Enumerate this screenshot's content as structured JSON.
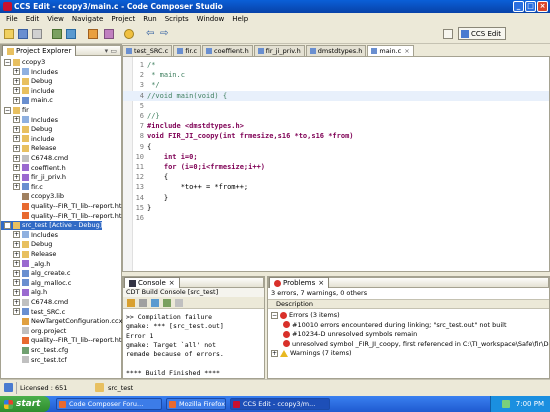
{
  "window": {
    "title": "CCS Edit - ccopy3/main.c - Code Composer Studio"
  },
  "menu": [
    "File",
    "Edit",
    "View",
    "Navigate",
    "Project",
    "Run",
    "Scripts",
    "Window",
    "Help"
  ],
  "toolbar": {
    "perspective": "CCS Edit"
  },
  "explorer": {
    "title": "Project Explorer",
    "rows": [
      {
        "label": "ccopy3",
        "indent": 0,
        "exp": "−",
        "icon": "project-icon"
      },
      {
        "label": "Includes",
        "indent": 1,
        "exp": "+",
        "icon": "includes-icon"
      },
      {
        "label": "Debug",
        "indent": 1,
        "exp": "+",
        "icon": "folder-icon"
      },
      {
        "label": "include",
        "indent": 1,
        "exp": "+",
        "icon": "folder-icon"
      },
      {
        "label": "main.c",
        "indent": 1,
        "exp": "+",
        "icon": "c-file-icon"
      },
      {
        "label": "fir",
        "indent": 0,
        "exp": "−",
        "icon": "project-icon"
      },
      {
        "label": "Includes",
        "indent": 1,
        "exp": "+",
        "icon": "includes-icon"
      },
      {
        "label": "Debug",
        "indent": 1,
        "exp": "+",
        "icon": "folder-icon"
      },
      {
        "label": "include",
        "indent": 1,
        "exp": "+",
        "icon": "folder-icon"
      },
      {
        "label": "Release",
        "indent": 1,
        "exp": "+",
        "icon": "folder-icon"
      },
      {
        "label": "C6748.cmd",
        "indent": 1,
        "exp": "+",
        "icon": "file-icon"
      },
      {
        "label": "coeffient.h",
        "indent": 1,
        "exp": "+",
        "icon": "h-file-icon"
      },
      {
        "label": "fir_ji_priv.h",
        "indent": 1,
        "exp": "+",
        "icon": "h-file-icon"
      },
      {
        "label": "fir.c",
        "indent": 1,
        "exp": "+",
        "icon": "c-file-icon"
      },
      {
        "label": "ccopy3.lib",
        "indent": 1,
        "exp": "",
        "icon": "lib-icon"
      },
      {
        "label": "quality--FIR_TI_lib--report.html",
        "indent": 1,
        "exp": "",
        "icon": "html-icon"
      },
      {
        "label": "quality--FIR_TI_lib--report.html",
        "indent": 1,
        "exp": "",
        "icon": "html-icon"
      },
      {
        "label": "src_test [Active - Debug]",
        "indent": 0,
        "exp": "−",
        "icon": "project-icon",
        "selected": true
      },
      {
        "label": "Includes",
        "indent": 1,
        "exp": "+",
        "icon": "includes-icon"
      },
      {
        "label": "Debug",
        "indent": 1,
        "exp": "+",
        "icon": "folder-icon"
      },
      {
        "label": "Release",
        "indent": 1,
        "exp": "+",
        "icon": "folder-icon"
      },
      {
        "label": "_alg.h",
        "indent": 1,
        "exp": "+",
        "icon": "h-file-icon"
      },
      {
        "label": "alg_create.c",
        "indent": 1,
        "exp": "+",
        "icon": "c-file-icon"
      },
      {
        "label": "alg_malloc.c",
        "indent": 1,
        "exp": "+",
        "icon": "c-file-icon"
      },
      {
        "label": "alg.h",
        "indent": 1,
        "exp": "+",
        "icon": "h-file-icon"
      },
      {
        "label": "C6748.cmd",
        "indent": 1,
        "exp": "+",
        "icon": "file-icon"
      },
      {
        "label": "test_SRC.c",
        "indent": 1,
        "exp": "+",
        "icon": "c-file-icon"
      },
      {
        "label": "NewTargetConfiguration.ccxml",
        "indent": 1,
        "exp": "",
        "icon": "xml-icon"
      },
      {
        "label": "org.project",
        "indent": 1,
        "exp": "",
        "icon": "file-icon"
      },
      {
        "label": "quality--FIR_TI_lib--report.html",
        "indent": 1,
        "exp": "",
        "icon": "html-icon"
      },
      {
        "label": "src_test.cfg",
        "indent": 1,
        "exp": "",
        "icon": "cfg-icon"
      },
      {
        "label": "src_test.tcf",
        "indent": 1,
        "exp": "",
        "icon": "file-icon"
      }
    ]
  },
  "editor_tabs": [
    {
      "label": "test_SRC.c",
      "active": false
    },
    {
      "label": "fir.c",
      "active": false
    },
    {
      "label": "coeffient.h",
      "active": false
    },
    {
      "label": "fir_ji_priv.h",
      "active": false
    },
    {
      "label": "dmstdtypes.h",
      "active": false
    },
    {
      "label": "main.c",
      "active": true
    }
  ],
  "code_lines": [
    {
      "n": "1",
      "text": "/*",
      "cls": "cmt"
    },
    {
      "n": "2",
      "text": " * main.c",
      "cls": "cmt"
    },
    {
      "n": "3",
      "text": " */",
      "cls": "cmt"
    },
    {
      "n": "4",
      "text": "//void main(void) {",
      "cls": "cmt"
    },
    {
      "n": "5",
      "text": "",
      "cls": ""
    },
    {
      "n": "6",
      "text": "//}",
      "cls": "cmt"
    },
    {
      "n": "7",
      "text": "#include <dmstdtypes.h>",
      "cls": "pp"
    },
    {
      "n": "8",
      "text": "void FIR_JI_coopy(int frmesize,s16 *to,s16 *from)",
      "cls": "kw"
    },
    {
      "n": "9",
      "text": "{",
      "cls": ""
    },
    {
      "n": "10",
      "text": "    int i=0;",
      "cls": "kw"
    },
    {
      "n": "11",
      "text": "    for (i=0;i<frmesize;i++)",
      "cls": "kw"
    },
    {
      "n": "12",
      "text": "    {",
      "cls": ""
    },
    {
      "n": "13",
      "text": "        *to++ = *from++;",
      "cls": ""
    },
    {
      "n": "14",
      "text": "    }",
      "cls": ""
    },
    {
      "n": "15",
      "text": "}",
      "cls": ""
    },
    {
      "n": "16",
      "text": "",
      "cls": ""
    }
  ],
  "console": {
    "tab": "Console",
    "title": "CDT Build Console [src_test]",
    "lines": [
      ">> Compilation failure",
      "gmake: *** [src_test.out]",
      "Error 1",
      "gmake: Target `all' not",
      "remade because of errors.",
      "",
      "**** Build Finished ****"
    ]
  },
  "problems": {
    "tab": "Problems",
    "summary": "3 errors, 7 warnings, 0 others",
    "column": "Description",
    "rows": [
      {
        "label": "Errors (3 items)",
        "indent": 0,
        "exp": "−",
        "type": "error-group"
      },
      {
        "label": "#10010 errors encountered during linking; \"src_test.out\" not built",
        "indent": 1,
        "exp": "",
        "type": "error"
      },
      {
        "label": "#10234-D  unresolved symbols remain",
        "indent": 1,
        "exp": "",
        "type": "error"
      },
      {
        "label": "unresolved symbol _FIR_JI_coopy, first referenced in C:\\TI_workspace\\Safe\\fir\\Debug\\fir.lib<t",
        "indent": 1,
        "exp": "",
        "type": "error"
      },
      {
        "label": "Warnings (7 items)",
        "indent": 0,
        "exp": "+",
        "type": "warning-group"
      }
    ]
  },
  "status": {
    "license": "Licensed : 651",
    "selection": "src_test"
  },
  "taskbar": {
    "start": "start",
    "tasks": [
      {
        "label": "Code Composer Foru...",
        "active": false
      },
      {
        "label": "Mozilla Firefox",
        "active": false
      },
      {
        "label": "CCS Edit - ccopy3/m...",
        "active": true
      }
    ],
    "clock": "7:00 PM"
  }
}
